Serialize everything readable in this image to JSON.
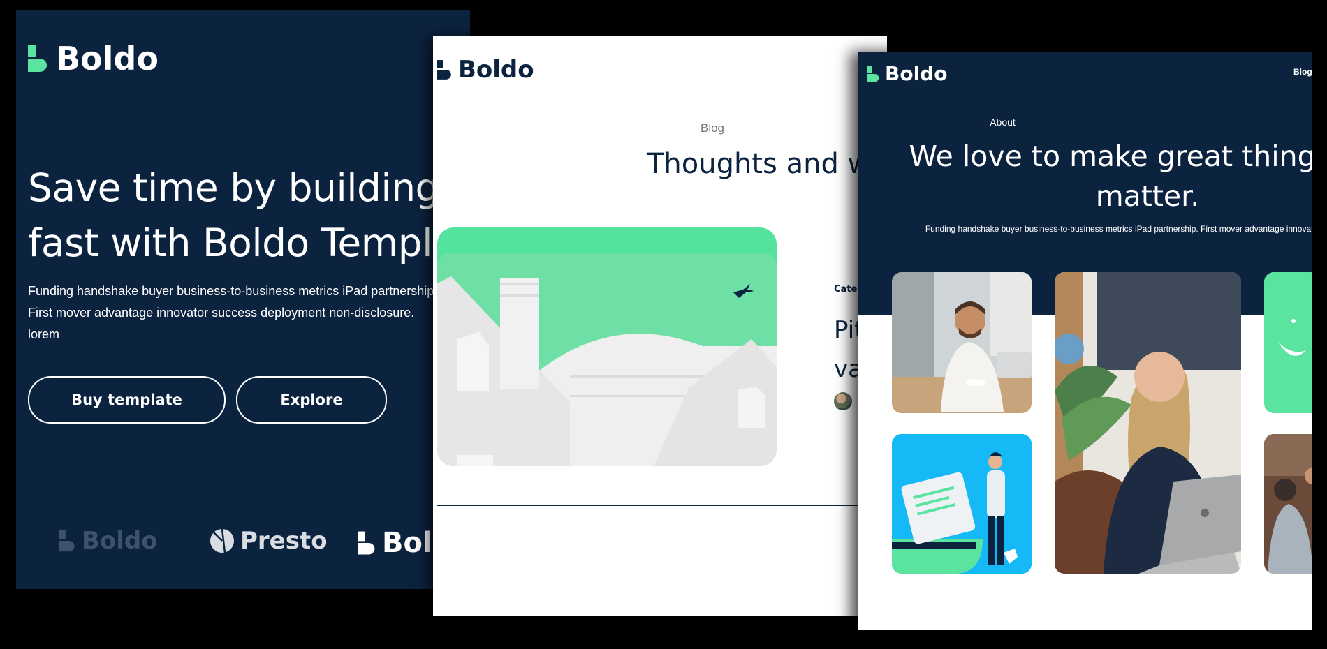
{
  "window1": {
    "logo_text": "Boldo",
    "headline_line1": "Save time by building",
    "headline_line2": "fast with Boldo Template",
    "description_line1": "Funding handshake buyer business-to-business metrics iPad partnership.",
    "description_line2": "First mover advantage innovator success deployment non-disclosure.",
    "description_line3": "lorem",
    "buy_button": "Buy template",
    "explore_button": "Explore",
    "brands": [
      "Boldo",
      "Presto",
      "Boldo"
    ],
    "colors": {
      "background": "#0c2340",
      "accent": "#5be3a0",
      "text": "#ffffff"
    }
  },
  "window2": {
    "logo_text": "Boldo",
    "eyebrow": "Blog",
    "title": "Thoughts and wo",
    "category": "Categ",
    "post_title_line1": "Pit",
    "post_title_line2": "va",
    "illustration_icon": "house-illustration",
    "colors": {
      "background": "#ffffff",
      "accent": "#54e39e",
      "text": "#0c2340"
    }
  },
  "window3": {
    "logo_text": "Boldo",
    "nav_item": "Blog",
    "eyebrow": "About",
    "headline_line1": "We love to make great things, thi",
    "headline_line2": "matter.",
    "description": "Funding handshake buyer business-to-business metrics iPad partnership. First mover advantage innovator success dep",
    "photos": [
      "man-on-phone-photo",
      "woman-on-phone-photo",
      "green-illustration-card",
      "person-with-documents-illustration",
      "people-at-table-photo"
    ],
    "colors": {
      "band": "#0c2340",
      "accent": "#5be3a0",
      "illustration_bg": "#14b9f5"
    }
  }
}
